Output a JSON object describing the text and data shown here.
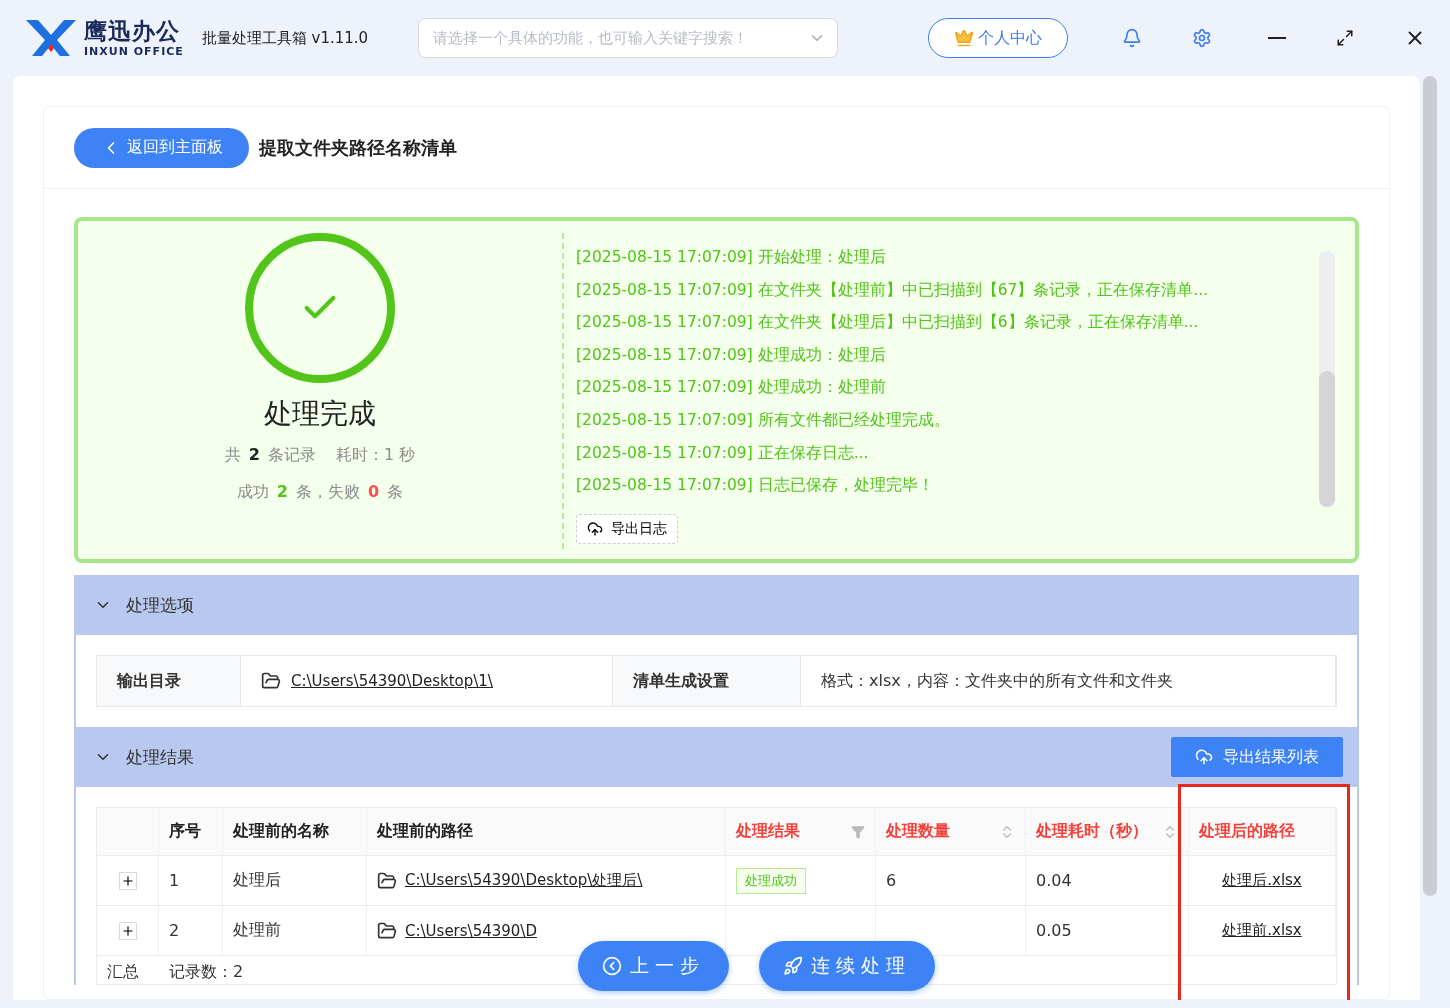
{
  "titlebar": {
    "logo_cn": "鹰迅办公",
    "logo_en": "INXUN OFFICE",
    "app_name": "批量处理工具箱 v1.11.0",
    "search": {
      "placeholder": "请选择一个具体的功能，也可输入关键字搜索！"
    },
    "user_button": "个人中心"
  },
  "header": {
    "back_button": "返回到主面板",
    "title": "提取文件夹路径名称清单"
  },
  "summary": {
    "title": "处理完成",
    "total_prefix": "共",
    "total": "2",
    "total_suffix": "条记录",
    "elapsed": "耗时：1 秒",
    "success_prefix": "成功",
    "success": "2",
    "success_suffix": "条，失败",
    "failed": "0",
    "failed_suffix": "条"
  },
  "log": {
    "lines": [
      "[2025-08-15 17:07:09] 开始处理：处理后",
      "[2025-08-15 17:07:09] 在文件夹【处理前】中已扫描到【67】条记录，正在保存清单...",
      "[2025-08-15 17:07:09] 在文件夹【处理后】中已扫描到【6】条记录，正在保存清单...",
      "[2025-08-15 17:07:09] 处理成功：处理后",
      "[2025-08-15 17:07:09] 处理成功：处理前",
      "[2025-08-15 17:07:09] 所有文件都已经处理完成。",
      "[2025-08-15 17:07:09] 正在保存日志...",
      "[2025-08-15 17:07:09] 日志已保存，处理完毕！"
    ],
    "export_button": "导出日志"
  },
  "options": {
    "title": "处理选项",
    "expanded": true,
    "output_label": "输出目录",
    "output_path": "C:\\Users\\54390\\Desktop\\1\\",
    "settings_label": "清单生成设置",
    "settings_value": "格式：xlsx，内容：文件夹中的所有文件和文件夹"
  },
  "results": {
    "title": "处理结果",
    "expanded": true,
    "export_button": "导出结果列表",
    "columns": [
      {
        "label": "序号",
        "highlighted": false,
        "kind": "plain"
      },
      {
        "label": "处理前的名称",
        "highlighted": false,
        "kind": "plain"
      },
      {
        "label": "处理前的路径",
        "highlighted": false,
        "kind": "plain"
      },
      {
        "label": "处理结果",
        "highlighted": true,
        "kind": "filter"
      },
      {
        "label": "处理数量",
        "highlighted": true,
        "kind": "sort"
      },
      {
        "label": "处理耗时（秒）",
        "highlighted": true,
        "kind": "sort"
      },
      {
        "label": "处理后的路径",
        "highlighted": true,
        "kind": "plain"
      }
    ],
    "rows": [
      {
        "index": "1",
        "name": "处理后",
        "path": "C:\\Users\\54390\\Desktop\\处理后\\",
        "status": "处理成功",
        "count": "6",
        "time": "0.04",
        "output": "处理后.xlsx"
      },
      {
        "index": "2",
        "name": "处理前",
        "path": "C:\\Users\\54390\\D",
        "time": "0.05",
        "output": "处理前.xlsx"
      }
    ],
    "footer_label": "汇总",
    "footer_value": "记录数：2"
  },
  "floating_buttons": {
    "previous": "上一步",
    "continue": "连续处理"
  }
}
